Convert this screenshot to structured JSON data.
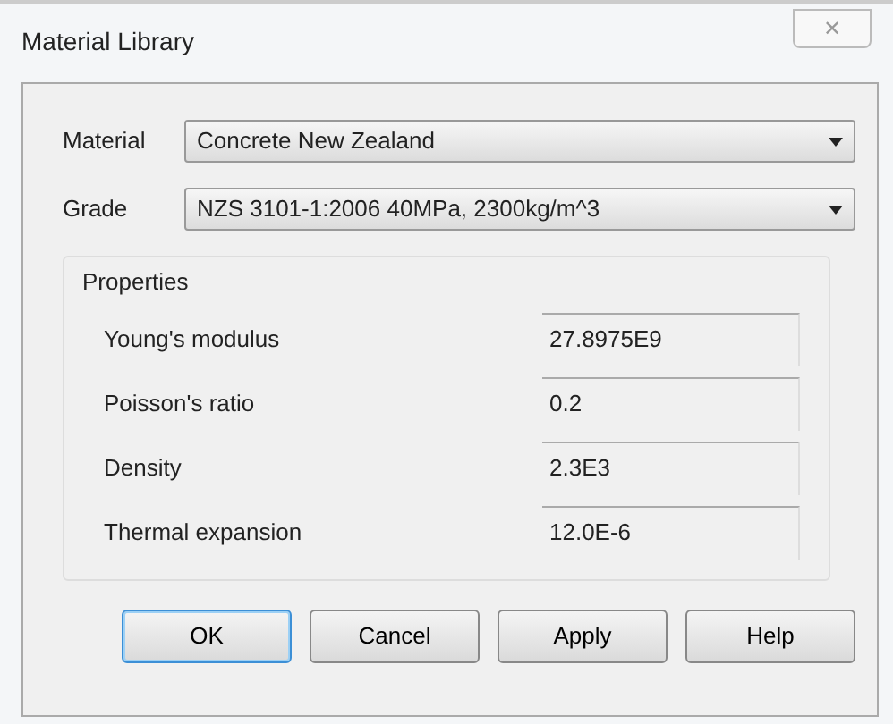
{
  "window": {
    "title": "Material Library",
    "close": "✕"
  },
  "fields": [
    {
      "label": "Material",
      "value": "Concrete New Zealand"
    },
    {
      "label": "Grade",
      "value": "NZS 3101-1:2006 40MPa, 2300kg/m^3"
    }
  ],
  "properties": {
    "title": "Properties",
    "rows": [
      {
        "label": "Young's modulus",
        "value": "27.8975E9"
      },
      {
        "label": "Poisson's ratio",
        "value": "0.2"
      },
      {
        "label": "Density",
        "value": "2.3E3"
      },
      {
        "label": "Thermal expansion",
        "value": "12.0E-6"
      }
    ]
  },
  "buttons": [
    {
      "label": "OK",
      "default": true
    },
    {
      "label": "Cancel",
      "default": false
    },
    {
      "label": "Apply",
      "default": false
    },
    {
      "label": "Help",
      "default": false
    }
  ]
}
